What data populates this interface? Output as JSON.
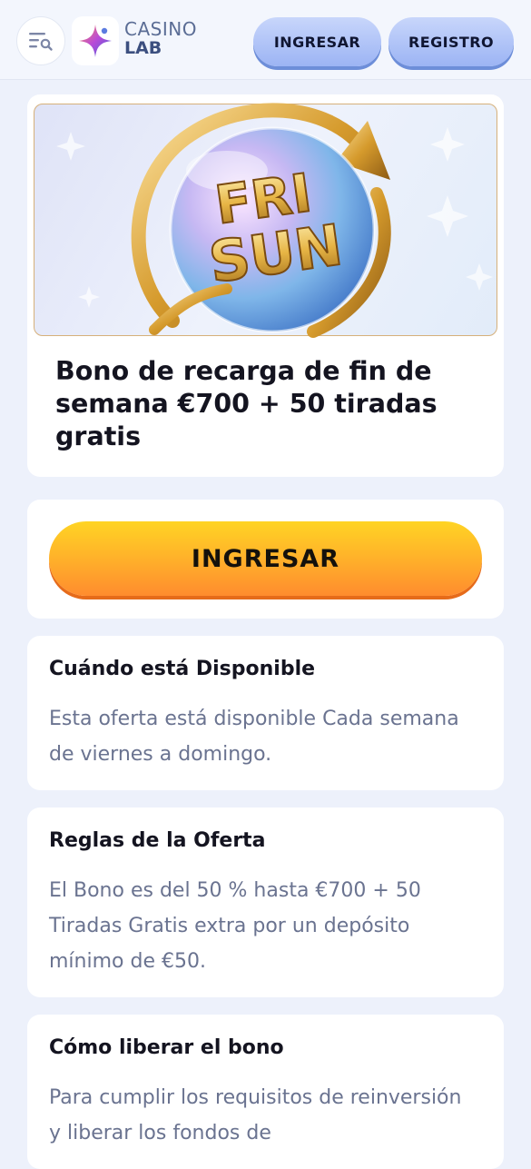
{
  "header": {
    "logo": {
      "line1": "CASINO",
      "line2": "LAB"
    },
    "login_label": "INGRESAR",
    "register_label": "REGISTRO",
    "icons": {
      "menu": "menu-search-icon",
      "logo": "star-sparkle-icon"
    }
  },
  "promo": {
    "image": {
      "badge_line1": "FRI",
      "badge_line2": "SUN"
    },
    "title": "Bono de recarga de fin de semana €700 + 50 tiradas gratis"
  },
  "cta": {
    "label": "INGRESAR"
  },
  "sections": [
    {
      "title": "Cuándo está Disponible",
      "body": "Esta oferta está disponible Cada semana de viernes a domingo."
    },
    {
      "title": "Reglas de la Oferta",
      "body": "El Bono es del 50 % hasta €700 + 50 Tiradas Gratis extra por un depósito mínimo de €50."
    },
    {
      "title": "Cómo liberar el bono",
      "body": "Para cumplir los requisitos de reinversión y liberar los fondos de"
    }
  ],
  "colors": {
    "page_bg": "#edf1fb",
    "cta_gradient_top": "#ffd424",
    "cta_gradient_bottom": "#ff8c2e",
    "header_button": "#a9bff7",
    "body_text": "#6a7390"
  }
}
